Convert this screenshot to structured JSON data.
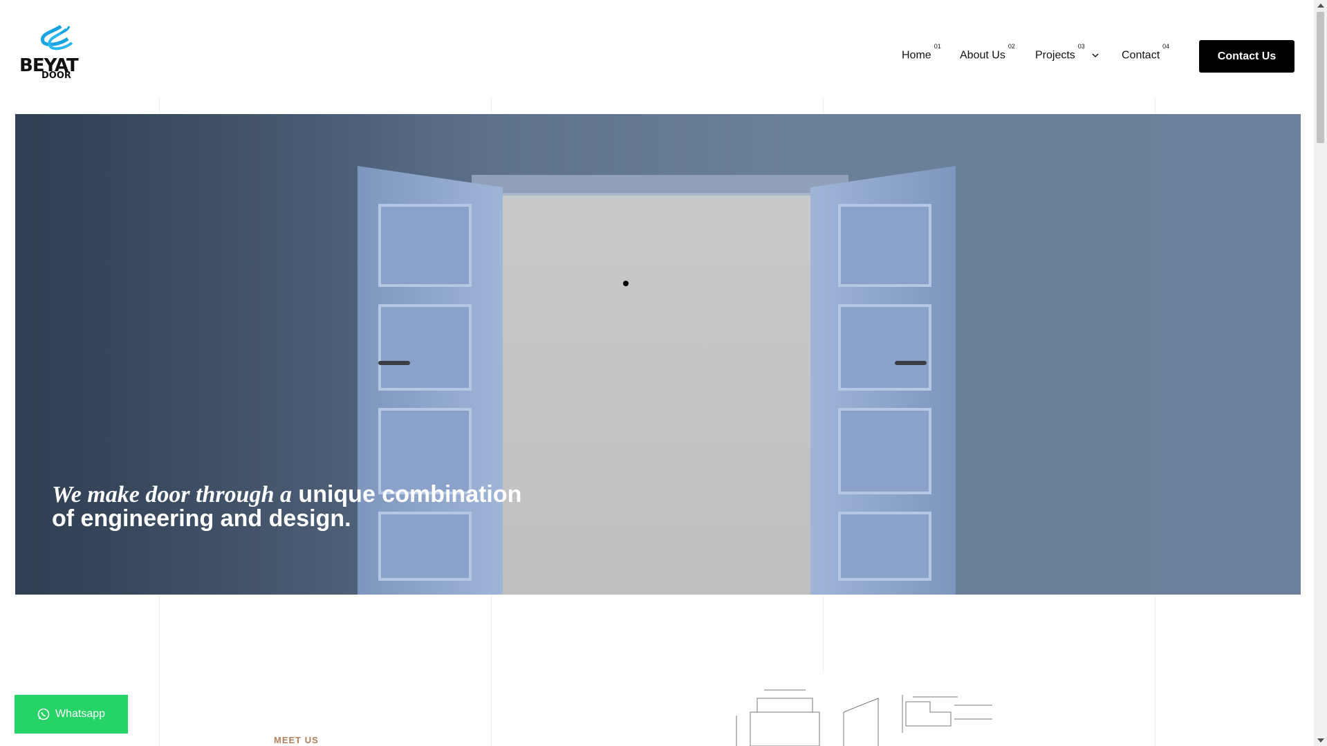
{
  "brand": {
    "logo_text": "BEYAT",
    "logo_sub": "DOOR",
    "accent": "#1aa3e0"
  },
  "nav": {
    "items": [
      {
        "label": "Home",
        "num": "01"
      },
      {
        "label": "About Us",
        "num": "02"
      },
      {
        "label": "Projects",
        "num": "03"
      },
      {
        "label": "Contact",
        "num": "04"
      }
    ],
    "cta_label": "Contact Us"
  },
  "hero": {
    "headline_italic": "We make door through a",
    "headline_rest": " unique combination",
    "headline_line2": "of engineering and design."
  },
  "section": {
    "eyebrow": "MEET US",
    "eyebrow_color": "#b0805a"
  },
  "whatsapp": {
    "label": "Whatsapp",
    "color": "#25d366",
    "icon": "whatsapp-icon"
  }
}
